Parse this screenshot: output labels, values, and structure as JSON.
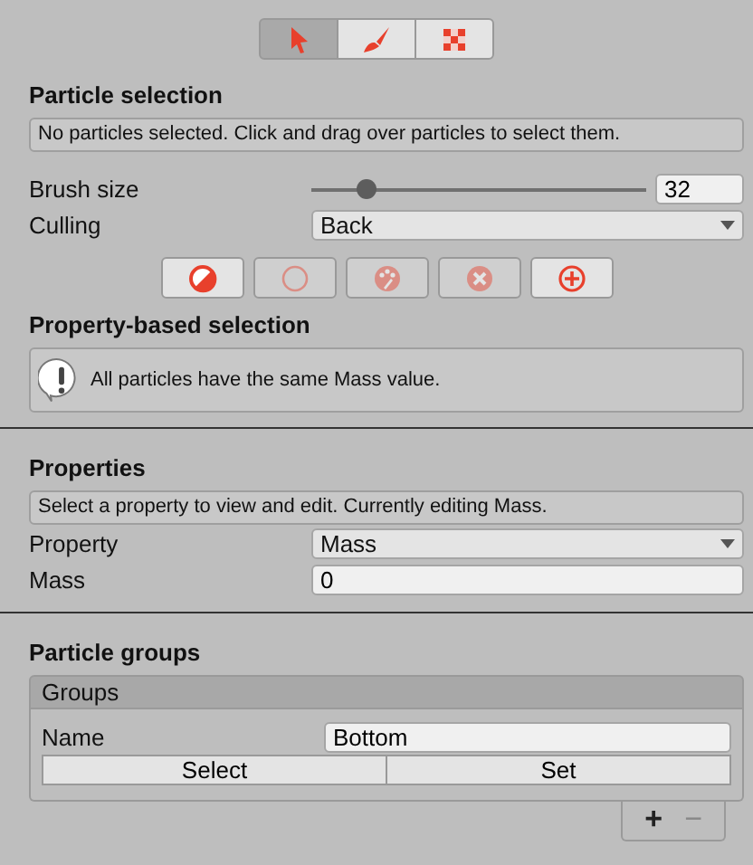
{
  "tool_tabs": [
    {
      "selected": true
    },
    {
      "selected": false
    },
    {
      "selected": false
    }
  ],
  "particle_selection": {
    "title": "Particle selection",
    "message": "No particles selected. Click and drag over particles to select them.",
    "brush_size": {
      "label": "Brush size",
      "level": 0.16,
      "value": "32"
    },
    "culling": {
      "label": "Culling",
      "value": "Back"
    },
    "actions": [
      {
        "disabled": false
      },
      {
        "disabled": true
      },
      {
        "disabled": true
      },
      {
        "disabled": true
      },
      {
        "disabled": false
      }
    ]
  },
  "property_selection": {
    "title": "Property-based selection",
    "message": "All particles have the same Mass value."
  },
  "properties": {
    "title": "Properties",
    "message": "Select a property to view and edit. Currently editing Mass.",
    "property": {
      "label": "Property",
      "value": "Mass"
    },
    "mass": {
      "label": "Mass",
      "value": "0"
    }
  },
  "particle_groups": {
    "title": "Particle groups",
    "list_header": "Groups",
    "items": [
      {
        "name_label": "Name",
        "name": "Bottom",
        "buttons": [
          "Select",
          "Set"
        ]
      }
    ],
    "footer": [
      {
        "label": "+",
        "disabled": false
      },
      {
        "label": "−",
        "disabled": true
      }
    ]
  }
}
